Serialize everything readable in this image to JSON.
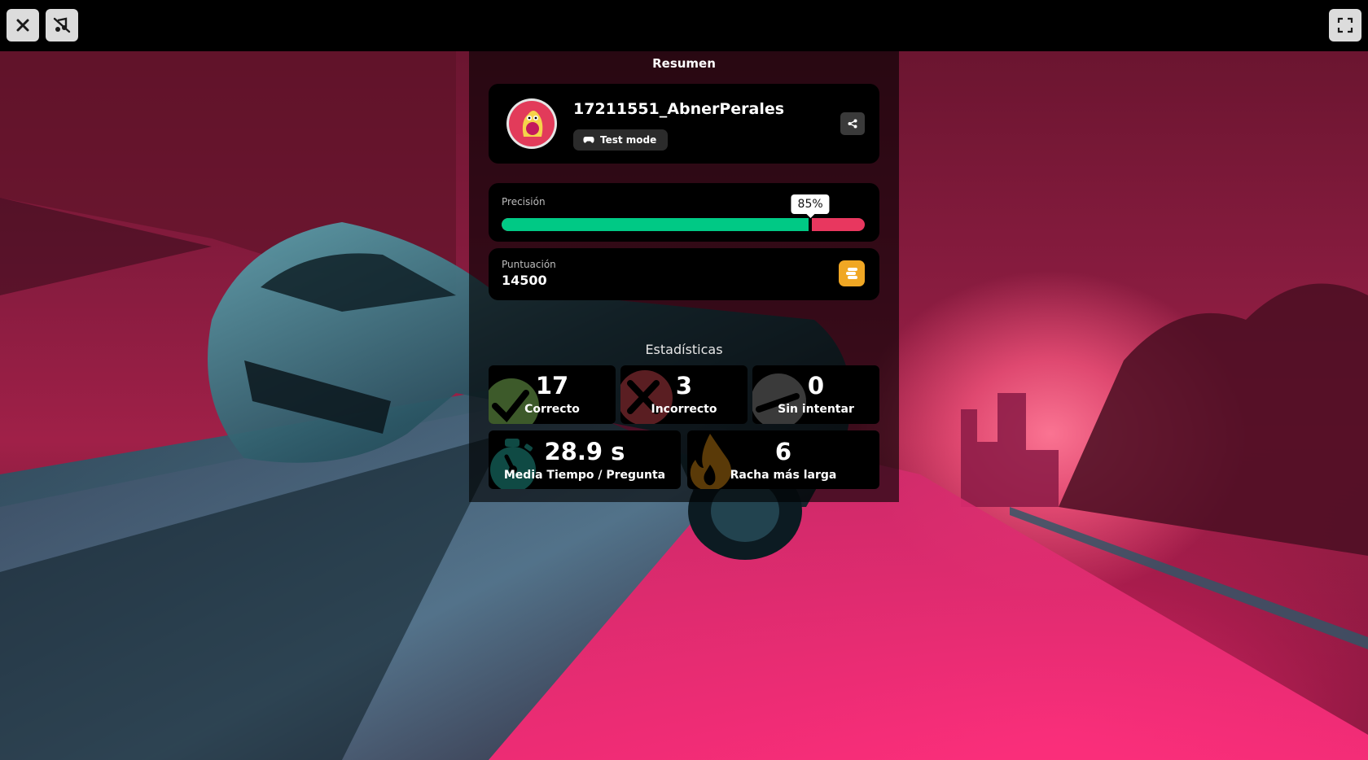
{
  "topbar": {
    "close_icon": "close-icon",
    "music_icon": "music-off-icon",
    "fullscreen_icon": "fullscreen-icon"
  },
  "panel": {
    "title": "Resumen"
  },
  "user": {
    "name": "17211551_AbnerPerales",
    "mode": "Test mode",
    "mode_icon": "gamepad-icon",
    "share_icon": "share-icon"
  },
  "accuracy": {
    "label": "Precisión",
    "value_text": "85%",
    "value": 0.85,
    "colors": {
      "correct": "#00c985",
      "incorrect": "#e8375f"
    }
  },
  "score": {
    "label": "Puntuación",
    "value": "14500",
    "icon": "coins-icon",
    "icon_color": "#f0a724"
  },
  "stats": {
    "title": "Estadísticas",
    "correct": {
      "value": "17",
      "label": "Correcto",
      "icon": "check-icon"
    },
    "incorrect": {
      "value": "3",
      "label": "Incorrecto",
      "icon": "cross-icon"
    },
    "skipped": {
      "value": "0",
      "label": "Sin intentar",
      "icon": "dash-icon"
    },
    "avg_time": {
      "value": "28.9 s",
      "label": "Media Tiempo / Pregunta",
      "icon": "stopwatch-icon"
    },
    "streak": {
      "value": "6",
      "label": "Racha más larga",
      "icon": "flame-icon"
    }
  }
}
